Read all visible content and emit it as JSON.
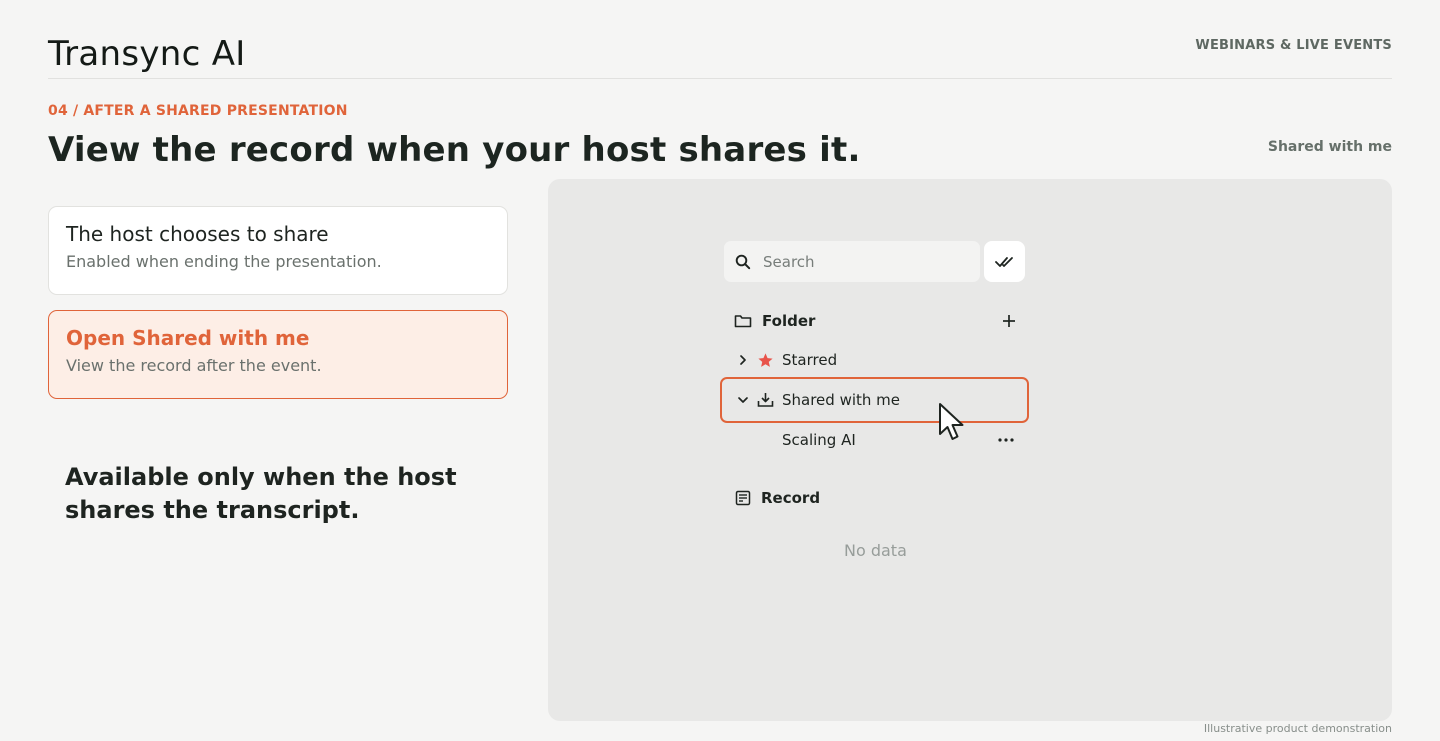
{
  "header": {
    "brand": "Transync AI",
    "section": "WEBINARS & LIVE EVENTS"
  },
  "eyebrow": "04 / AFTER A SHARED PRESENTATION",
  "headline": "View the record when your host shares it.",
  "context_label": "Shared with me",
  "steps": [
    {
      "title": "The host chooses to share",
      "desc": "Enabled when ending the presentation.",
      "active": false
    },
    {
      "title": "Open Shared with me",
      "desc": "View the record after the event.",
      "active": true
    }
  ],
  "note": "Available only when the host shares the transcript.",
  "demo": {
    "search_placeholder": "Search",
    "folder_label": "Folder",
    "starred_label": "Starred",
    "shared_label": "Shared with me",
    "child_item": "Scaling AI",
    "record_label": "Record",
    "empty_text": "No data",
    "icons": [
      "search-icon",
      "double-check-icon",
      "folder-icon",
      "plus-icon",
      "chevron-right-icon",
      "star-icon",
      "chevron-down-icon",
      "download-icon",
      "more-icon",
      "record-icon",
      "cursor-icon"
    ]
  },
  "caption": "Illustrative product demonstration",
  "colors": {
    "accent": "#e0643a",
    "star": "#e8534a",
    "background": "#f5f5f4",
    "panel": "#e8e8e7"
  }
}
